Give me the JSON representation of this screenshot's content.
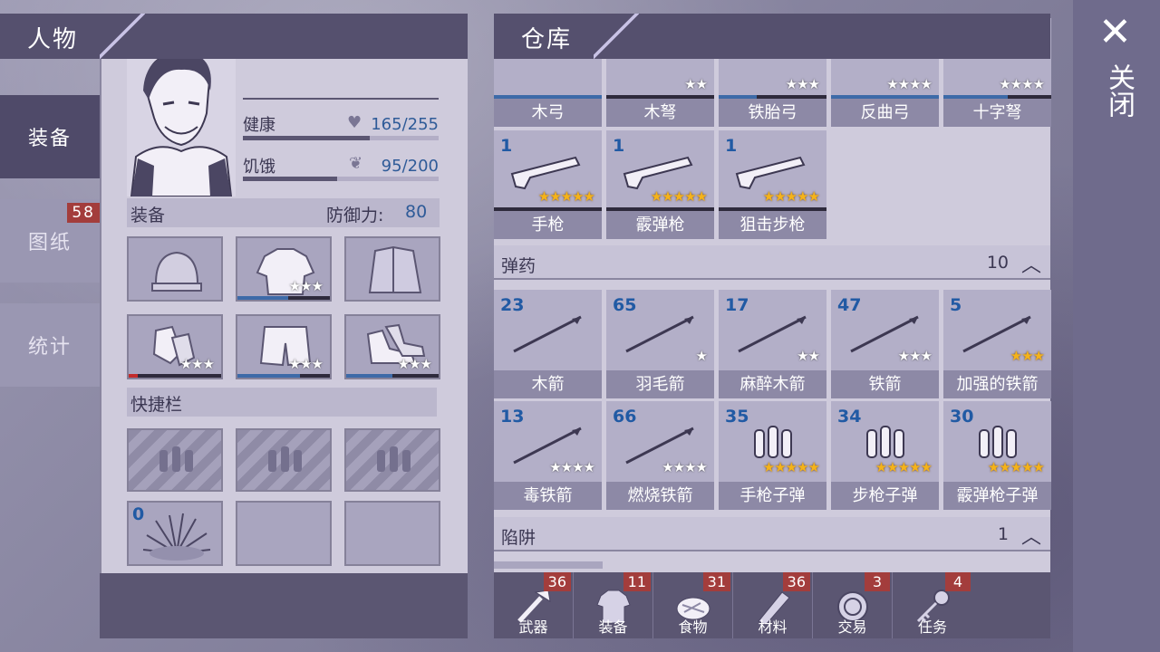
{
  "character": {
    "title": "人物",
    "tabs": [
      {
        "label": "装备",
        "active": true
      },
      {
        "label": "图纸",
        "badge": "58"
      },
      {
        "label": "统计"
      }
    ],
    "health": {
      "label": "健康",
      "value": "165/255",
      "fraction": 0.65
    },
    "hunger": {
      "label": "饥饿",
      "value": "95/200",
      "fraction": 0.48
    },
    "equipment": {
      "label": "装备",
      "defense_label": "防御力:",
      "defense_value": "80"
    },
    "quickbar": {
      "label": "快捷栏",
      "slot_count": "0"
    }
  },
  "warehouse": {
    "title": "仓库",
    "bows": [
      {
        "label": "木弓",
        "stars": "",
        "durability": 1.0
      },
      {
        "label": "木弩",
        "stars": "★★",
        "durability": 0.0
      },
      {
        "label": "铁胎弓",
        "stars": "★★★",
        "durability": 0.35
      },
      {
        "label": "反曲弓",
        "stars": "★★★★",
        "durability": 1.0
      },
      {
        "label": "十字弩",
        "stars": "★★★★",
        "durability": 0.6
      }
    ],
    "guns": [
      {
        "count": "1",
        "label": "手枪",
        "stars": "★★★★★"
      },
      {
        "count": "1",
        "label": "霰弹枪",
        "stars": "★★★★★"
      },
      {
        "count": "1",
        "label": "狙击步枪",
        "stars": "★★★★★"
      }
    ],
    "ammo_header": {
      "label": "弹药",
      "count": "10"
    },
    "ammo": [
      {
        "count": "23",
        "label": "木箭",
        "stars": ""
      },
      {
        "count": "65",
        "label": "羽毛箭",
        "stars": "★"
      },
      {
        "count": "17",
        "label": "麻醉木箭",
        "stars": "★★"
      },
      {
        "count": "47",
        "label": "铁箭",
        "stars": "★★★"
      },
      {
        "count": "5",
        "label": "加强的铁箭",
        "stars": "★★★",
        "gold": true
      },
      {
        "count": "13",
        "label": "毒铁箭",
        "stars": "★★★★"
      },
      {
        "count": "66",
        "label": "燃烧铁箭",
        "stars": "★★★★"
      },
      {
        "count": "35",
        "label": "手枪子弹",
        "stars": "★★★★★",
        "gold": true
      },
      {
        "count": "34",
        "label": "步枪子弹",
        "stars": "★★★★★",
        "gold": true
      },
      {
        "count": "30",
        "label": "霰弹枪子弹",
        "stars": "★★★★★",
        "gold": true
      }
    ],
    "trap_header": {
      "label": "陷阱",
      "count": "1"
    },
    "bottom_tabs": [
      {
        "label": "武器",
        "badge": "36"
      },
      {
        "label": "装备",
        "badge": "11"
      },
      {
        "label": "食物",
        "badge": "31"
      },
      {
        "label": "材料",
        "badge": "36"
      },
      {
        "label": "交易",
        "badge": "3"
      },
      {
        "label": "任务",
        "badge": "4"
      }
    ]
  },
  "close": {
    "label": "关闭"
  }
}
